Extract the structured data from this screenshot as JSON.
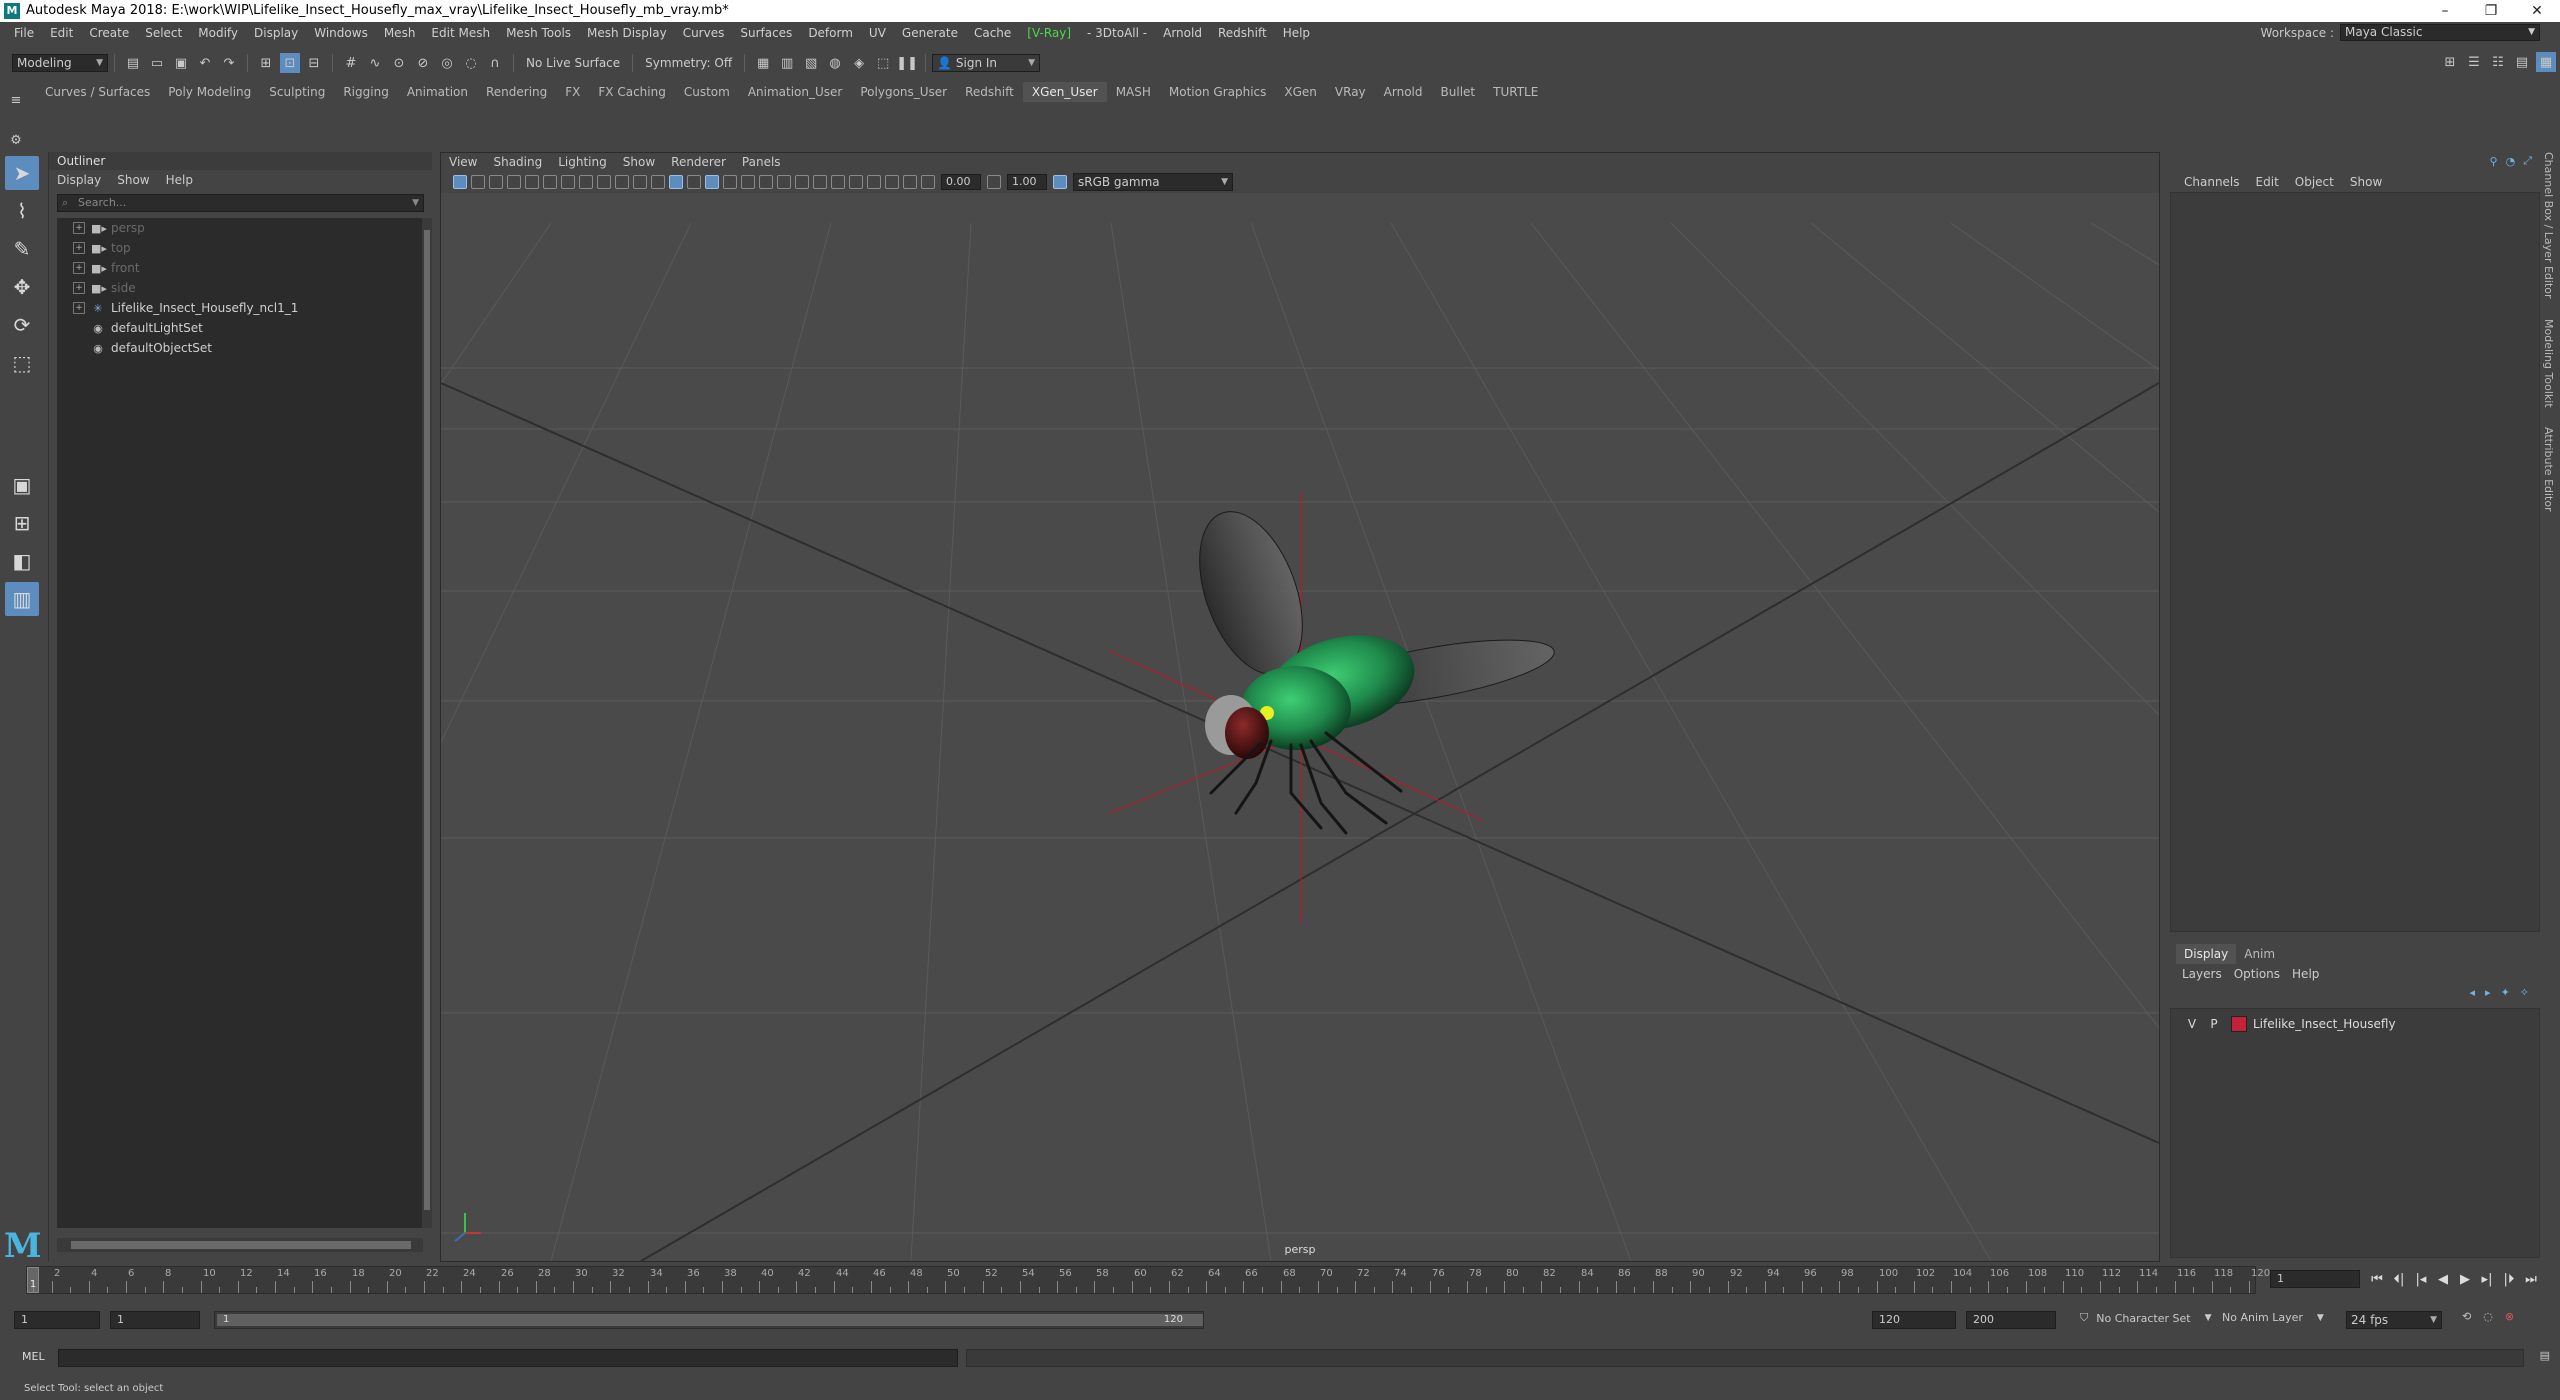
{
  "app": {
    "title": "Autodesk Maya 2018: E:\\work\\WIP\\Lifelike_Insect_Housefly_max_vray\\Lifelike_Insect_Housefly_mb_vray.mb*",
    "logo_letter": "M"
  },
  "menubar": {
    "items": [
      "File",
      "Edit",
      "Create",
      "Select",
      "Modify",
      "Display",
      "Windows",
      "Mesh",
      "Edit Mesh",
      "Mesh Tools",
      "Mesh Display",
      "Curves",
      "Surfaces",
      "Deform",
      "UV",
      "Generate",
      "Cache",
      "[V-Ray]",
      "- 3DtoAll -",
      "Arnold",
      "Redshift",
      "Help"
    ],
    "workspace_label": "Workspace :",
    "workspace_value": "Maya Classic"
  },
  "statusline": {
    "mode": "Modeling",
    "live_surface": "No Live Surface",
    "symmetry": "Symmetry: Off",
    "sign_in": "Sign In"
  },
  "shelf": {
    "tabs": [
      "Curves / Surfaces",
      "Poly Modeling",
      "Sculpting",
      "Rigging",
      "Animation",
      "Rendering",
      "FX",
      "FX Caching",
      "Custom",
      "Animation_User",
      "Polygons_User",
      "Redshift",
      "XGen_User",
      "MASH",
      "Motion Graphics",
      "XGen",
      "VRay",
      "Arnold",
      "Bullet",
      "TURTLE"
    ],
    "active_tab": "XGen_User"
  },
  "outliner": {
    "title": "Outliner",
    "menu": [
      "Display",
      "Show",
      "Help"
    ],
    "search_placeholder": "Search...",
    "nodes": [
      {
        "label": "persp",
        "icon": "camera-icon",
        "dim": true
      },
      {
        "label": "top",
        "icon": "camera-icon",
        "dim": true
      },
      {
        "label": "front",
        "icon": "camera-icon",
        "dim": true
      },
      {
        "label": "side",
        "icon": "camera-icon",
        "dim": true
      },
      {
        "label": "Lifelike_Insect_Housefly_ncl1_1",
        "icon": "group-icon",
        "dim": false
      },
      {
        "label": "defaultLightSet",
        "icon": "set-icon",
        "dim": false
      },
      {
        "label": "defaultObjectSet",
        "icon": "set-icon",
        "dim": false
      }
    ]
  },
  "viewport": {
    "menu": [
      "View",
      "Shading",
      "Lighting",
      "Show",
      "Renderer",
      "Panels"
    ],
    "exposure": "0.00",
    "gamma": "1.00",
    "color_space": "sRGB gamma",
    "camera_label": "persp"
  },
  "channelbox": {
    "menu": [
      "Channels",
      "Edit",
      "Object",
      "Show"
    ],
    "side_tabs": [
      "Channel Box / Layer Editor",
      "Modeling Toolkit",
      "Attribute Editor"
    ]
  },
  "layers": {
    "tabs": [
      "Display",
      "Anim"
    ],
    "active_tab": "Display",
    "menu": [
      "Layers",
      "Options",
      "Help"
    ],
    "rows": [
      {
        "v": "V",
        "p": "P",
        "name": "Lifelike_Insect_Housefly",
        "color": "#c4213b"
      }
    ]
  },
  "timeslider": {
    "labels": [
      "1",
      "2",
      "4",
      "6",
      "8",
      "10",
      "12",
      "14",
      "16",
      "18",
      "20",
      "22",
      "24",
      "26",
      "28",
      "30",
      "32",
      "34",
      "36",
      "38",
      "40",
      "42",
      "44",
      "46",
      "48",
      "50",
      "52",
      "54",
      "56",
      "58",
      "60",
      "62",
      "64",
      "66",
      "68",
      "70",
      "72",
      "74",
      "76",
      "78",
      "80",
      "82",
      "84",
      "86",
      "88",
      "90",
      "92",
      "94",
      "96",
      "98",
      "100",
      "102",
      "104",
      "106",
      "108",
      "110",
      "112",
      "114",
      "116",
      "118",
      "120"
    ],
    "current_frame": "1",
    "frame_field": "1"
  },
  "range": {
    "start": "1",
    "start_inner": "1",
    "range_start_label": "1",
    "range_end_label": "120",
    "end_inner": "120",
    "end": "200",
    "character_set": "No Character Set",
    "anim_layer": "No Anim Layer",
    "fps": "24 fps"
  },
  "commandline": {
    "label": "MEL"
  },
  "helpline": {
    "text": "Select Tool: select an object"
  },
  "colors": {
    "accent": "#5d8cbf",
    "vray_green": "#4cd84c",
    "layer_red": "#c4213b",
    "fly_body": "#1f8a4c"
  }
}
